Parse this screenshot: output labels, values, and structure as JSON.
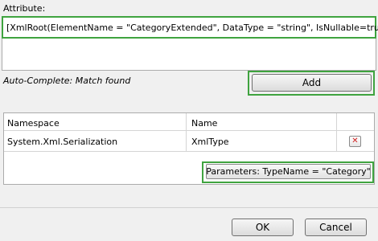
{
  "attribute_label": "Attribute:",
  "attribute_text": "[XmlRoot(ElementName = \"CategoryExtended\", DataType = \"string\", IsNullable=true)]",
  "status_text": "Auto-Complete: Match found",
  "add_button": "Add",
  "grid": {
    "columns": [
      "Namespace",
      "Name"
    ],
    "rows": [
      {
        "namespace": "System.Xml.Serialization",
        "name": "XmlType"
      }
    ]
  },
  "delete_icon": "delete-x-icon",
  "delete_glyph": "✕",
  "params_button": "Parameters: TypeName = \"Category\"",
  "ok_button": "OK",
  "cancel_button": "Cancel",
  "colors": {
    "highlight": "#3fa33f",
    "delete": "#d02020"
  }
}
